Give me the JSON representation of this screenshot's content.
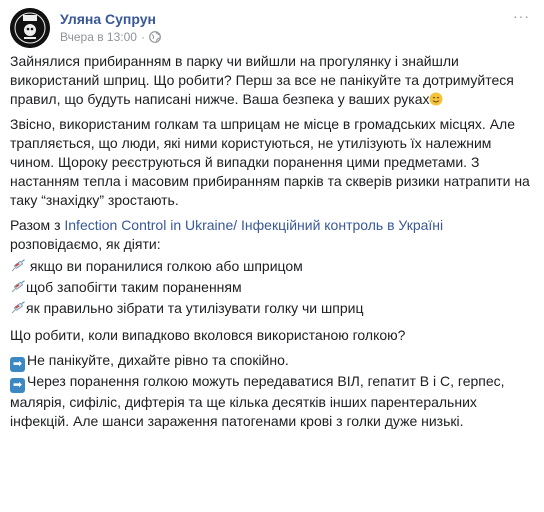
{
  "post": {
    "author": "Уляна Супрун",
    "timestamp": "Вчера в 13:00",
    "separator": "·",
    "more_label": "···"
  },
  "body": {
    "p1": "Зайнялися прибиранням в парку чи вийшли на прогулянку і знайшли використаний шприц. Що робити? Перш за все не панікуйте та дотримуйтеся правил, що будуть написані нижче. Ваша безпека у ваших руках",
    "p2": "Звісно, використаним голкам та шприцам не місце в громадських місцях. Але трапляється, що люди, які ними користуються, не утилізують їх належним чином. Щороку реєструються й випадки поранення цими предметами. З настанням тепла і масовим прибиранням парків та скверів ризики натрапити на таку “знахідку” зростають.",
    "p3_prefix": "Разом з",
    "p3_link": "Infection Control in Ukraine/ Інфекційний контроль в Україні",
    "p3_suffix": "розповідаємо, як діяти:",
    "list": [
      "якщо ви поранилися голкою або шприцом",
      "щоб запобігти таким пораненням",
      "як правильно зібрати та утилізувати голку чи шприц"
    ],
    "question": "Що робити, коли випадково вколовся використаною голкою?",
    "steps": [
      "Не панікуйте, дихайте рівно та спокійно.",
      "Через поранення голкою можуть передаватися ВІЛ, гепатит В і С, герпес, малярія, сифіліс, дифтерія та ще кілька десятків інших парентеральних інфекцій. Але шанси зараження патогенами крові з голки дуже низькі."
    ]
  }
}
